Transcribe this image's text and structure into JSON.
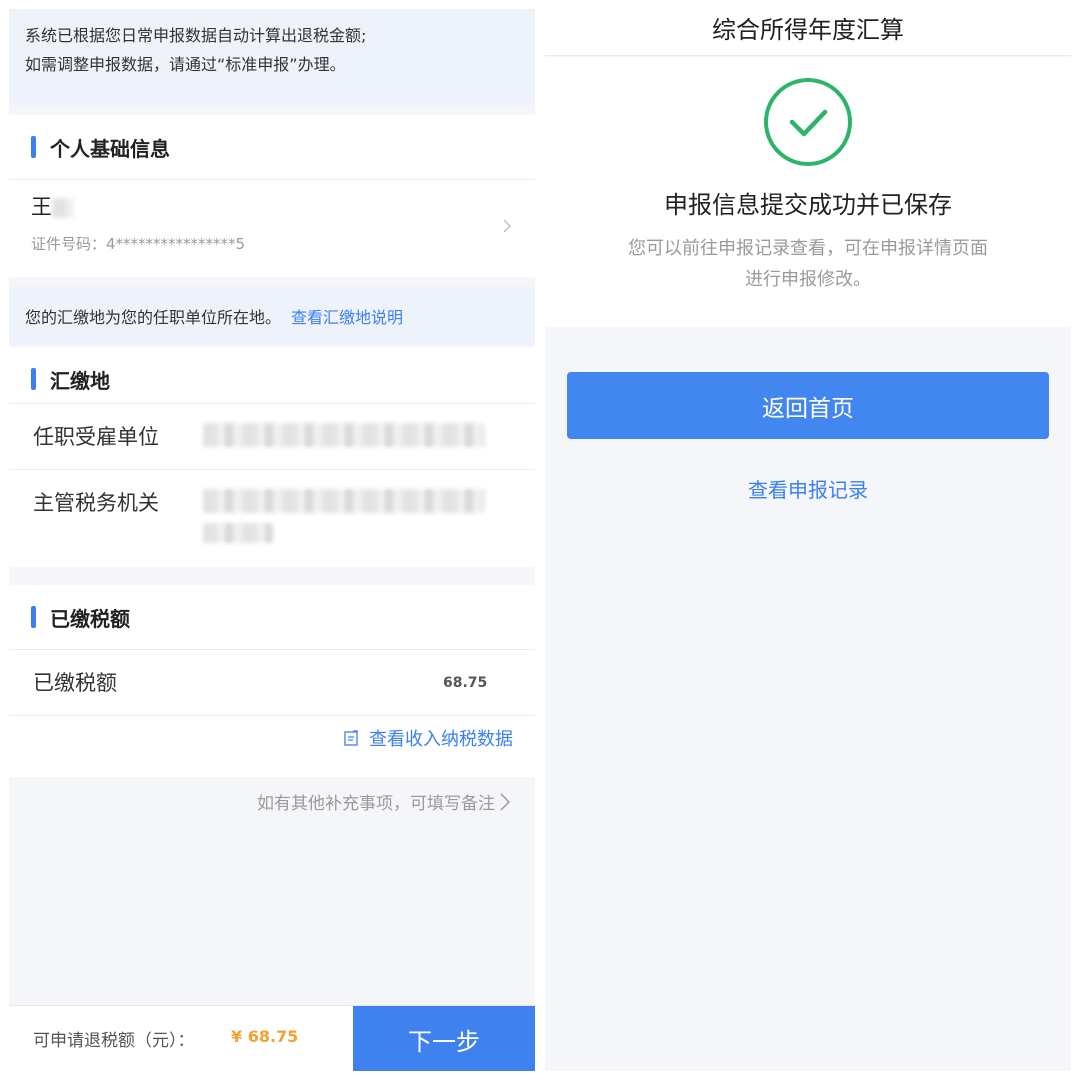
{
  "left": {
    "notice_top": {
      "line1": "系统已根据您日常申报数据自动计算出退税金额;",
      "line2": "如需调整申报数据，请通过“标准申报”办理。"
    },
    "personal": {
      "title": "个人基础信息",
      "name": "王",
      "id_label": "证件号码：",
      "id_value": "4****************5"
    },
    "notice_mid": {
      "text": "您的汇缴地为您的任职单位所在地。",
      "link": "查看汇缴地说明"
    },
    "filing_place": {
      "title": "汇缴地",
      "employer_label": "任职受雇单位",
      "tax_office_label": "主管税务机关"
    },
    "tax_paid": {
      "title": "已缴税额",
      "label": "已缴税额",
      "value": "68.75"
    },
    "view_income_link": "查看收入纳税数据",
    "remark_link": "如有其他补充事项，可填写备注",
    "bottom": {
      "refund_label": "可申请退税额（元）：",
      "refund_value": "¥ 68.75",
      "next_button": "下一步"
    }
  },
  "right": {
    "header_title": "综合所得年度汇算",
    "success_title": "申报信息提交成功并已保存",
    "success_desc_line1": "您可以前往申报记录查看，可在申报详情页面",
    "success_desc_line2": "进行申报修改。",
    "home_button": "返回首页",
    "records_link": "查看申报记录"
  },
  "colors": {
    "accent": "#3b7ff0",
    "button": "#4286ef",
    "refund_amount": "#f0a232",
    "success_green": "#2db36a"
  },
  "icons": [
    "chevron-right-icon",
    "edit-doc-icon",
    "success-check-icon"
  ]
}
